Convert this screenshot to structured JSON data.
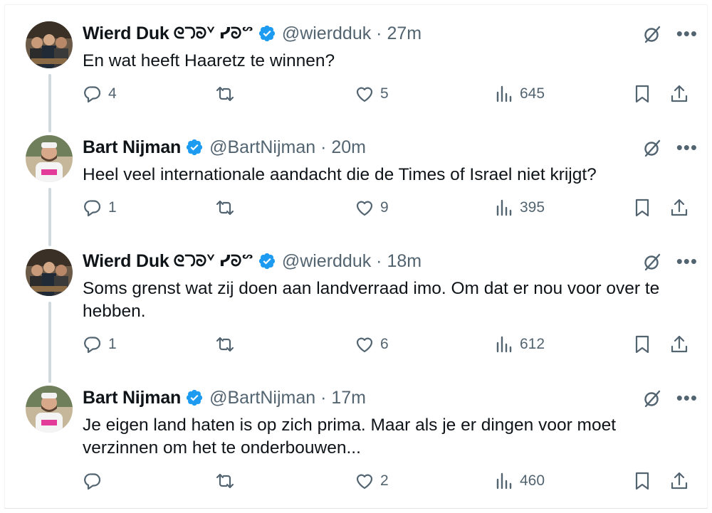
{
  "thread": [
    {
      "name": "Wierd Duk",
      "name_glyphs": "ᘓᘄᘐᘁ ᓯᘐᔥ",
      "verified": true,
      "handle_time": "@wierdduk · 27m",
      "text": "En wat heeft Haaretz te winnen?",
      "replies": "4",
      "reposts": "",
      "likes": "5",
      "views": "645",
      "avatar": "group-photo"
    },
    {
      "name": "Bart Nijman",
      "name_glyphs": "",
      "verified": true,
      "handle_time": "@BartNijman · 20m",
      "text": "Heel veel internationale aandacht die de Times of Israel niet krijgt?",
      "replies": "1",
      "reposts": "",
      "likes": "9",
      "views": "395",
      "avatar": "portrait-photo"
    },
    {
      "name": "Wierd Duk",
      "name_glyphs": "ᘓᘄᘐᘁ ᓯᘐᔥ",
      "verified": true,
      "handle_time": "@wierdduk · 18m",
      "text": "Soms grenst wat zij doen aan landverraad imo. Om dat er nou voor over te hebben.",
      "replies": "1",
      "reposts": "",
      "likes": "6",
      "views": "612",
      "avatar": "group-photo"
    },
    {
      "name": "Bart Nijman",
      "name_glyphs": "",
      "verified": true,
      "handle_time": "@BartNijman · 17m",
      "text": "Je eigen land haten is op zich prima. Maar als je er dingen voor moet verzinnen om het te onderbouwen...",
      "replies": "",
      "reposts": "",
      "likes": "2",
      "views": "460",
      "avatar": "portrait-photo"
    }
  ],
  "icons": {
    "reply": "reply-icon",
    "repost": "repost-icon",
    "like": "like-icon",
    "views": "views-icon",
    "bookmark": "bookmark-icon",
    "share": "share-icon",
    "grok": "grok-icon",
    "more": "more-icon",
    "verified": "verified-badge-icon"
  },
  "colors": {
    "text": "#0f1419",
    "secondary": "#536471",
    "verified": "#1d9bf0",
    "thread_line": "#cfd9de"
  }
}
